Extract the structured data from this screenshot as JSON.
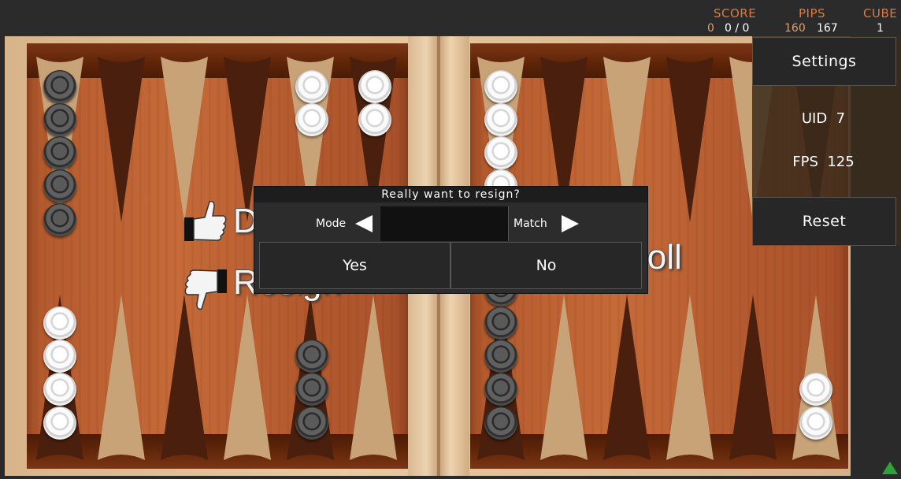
{
  "scoreboard": {
    "score_label": "SCORE",
    "score_left": "0",
    "score_rest": "0 / 0",
    "pips_label": "PIPS",
    "pips_player": "160",
    "pips_opponent": "167",
    "cube_label": "CUBE",
    "cube_value": "1"
  },
  "sidebar": {
    "settings_label": "Settings",
    "uid_label": "UID",
    "uid_value": "7",
    "fps_label": "FPS",
    "fps_value": "125",
    "reset_label": "Reset"
  },
  "board_words": {
    "double": "D",
    "resign": "Resign",
    "roll": "Roll"
  },
  "dialog": {
    "title": "Really want to resign?",
    "mode_label": "Mode",
    "match_label": "Match",
    "yes_label": "Yes",
    "no_label": "No"
  },
  "colors": {
    "accent": "#e0783a",
    "panel": "#272727",
    "indicator": "#2fa33a"
  }
}
